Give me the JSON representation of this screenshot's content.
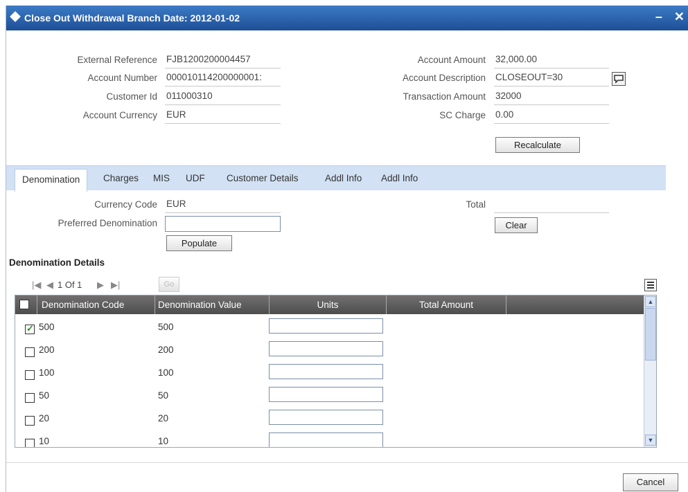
{
  "window": {
    "title": "Close Out Withdrawal  Branch Date: 2012-01-02",
    "controls": "– ✕"
  },
  "header_fields": {
    "external_reference": {
      "label": "External Reference",
      "value": "FJB1200200004457"
    },
    "account_number": {
      "label": "Account Number",
      "value": "000010114200000001:"
    },
    "customer_id": {
      "label": "Customer Id",
      "value": "011000310"
    },
    "account_currency": {
      "label": "Account Currency",
      "value": "EUR"
    },
    "account_amount": {
      "label": "Account Amount",
      "value": "32,000.00"
    },
    "account_description": {
      "label": "Account Description",
      "value": "CLOSEOUT=30"
    },
    "transaction_amount": {
      "label": "Transaction Amount",
      "value": "32000"
    },
    "sc_charge": {
      "label": "SC Charge",
      "value": "0.00"
    }
  },
  "buttons": {
    "recalculate": "Recalculate",
    "clear": "Clear",
    "populate": "Populate",
    "go": "Go",
    "cancel": "Cancel"
  },
  "tabs": [
    {
      "label": "Denomination",
      "active": true
    },
    {
      "label": "Charges"
    },
    {
      "label": "MIS"
    },
    {
      "label": "UDF"
    },
    {
      "label": "Customer Details"
    },
    {
      "label": "Addl Info"
    },
    {
      "label": "Addl Info"
    }
  ],
  "denomination_panel": {
    "currency_code": {
      "label": "Currency Code",
      "value": "EUR"
    },
    "preferred_denomination": {
      "label": "Preferred Denomination",
      "value": ""
    },
    "total": {
      "label": "Total",
      "value": ""
    }
  },
  "denomination_details": {
    "title": "Denomination Details",
    "pager": {
      "text": "1 Of 1",
      "first": "|◀",
      "prev": "◀",
      "next": "▶",
      "last": "▶|"
    },
    "columns": [
      "Denomination Code",
      "Denomination Value",
      "Units",
      "Total Amount"
    ],
    "rows": [
      {
        "code": "500",
        "value": "500",
        "units": "",
        "total": "",
        "checked": true
      },
      {
        "code": "200",
        "value": "200",
        "units": "",
        "total": "",
        "checked": false
      },
      {
        "code": "100",
        "value": "100",
        "units": "",
        "total": "",
        "checked": false
      },
      {
        "code": "50",
        "value": "50",
        "units": "",
        "total": "",
        "checked": false
      },
      {
        "code": "20",
        "value": "20",
        "units": "",
        "total": "",
        "checked": false
      },
      {
        "code": "10",
        "value": "10",
        "units": "",
        "total": "",
        "checked": false
      }
    ]
  },
  "icons": {
    "window_icon": "diamond-icon",
    "account_description_lookup": "speech-bubble-icon",
    "grid_settings": "list-view-icon"
  }
}
